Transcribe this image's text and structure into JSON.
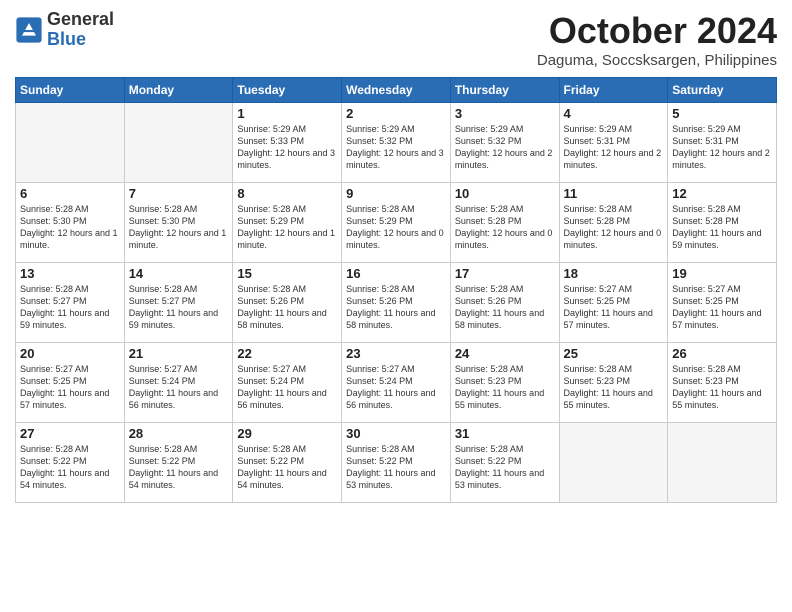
{
  "header": {
    "logo": {
      "general": "General",
      "blue": "Blue"
    },
    "month": "October 2024",
    "location": "Daguma, Soccsksargen, Philippines"
  },
  "weekdays": [
    "Sunday",
    "Monday",
    "Tuesday",
    "Wednesday",
    "Thursday",
    "Friday",
    "Saturday"
  ],
  "weeks": [
    [
      null,
      null,
      {
        "day": 1,
        "sunrise": "Sunrise: 5:29 AM",
        "sunset": "Sunset: 5:33 PM",
        "daylight": "Daylight: 12 hours and 3 minutes."
      },
      {
        "day": 2,
        "sunrise": "Sunrise: 5:29 AM",
        "sunset": "Sunset: 5:32 PM",
        "daylight": "Daylight: 12 hours and 3 minutes."
      },
      {
        "day": 3,
        "sunrise": "Sunrise: 5:29 AM",
        "sunset": "Sunset: 5:32 PM",
        "daylight": "Daylight: 12 hours and 2 minutes."
      },
      {
        "day": 4,
        "sunrise": "Sunrise: 5:29 AM",
        "sunset": "Sunset: 5:31 PM",
        "daylight": "Daylight: 12 hours and 2 minutes."
      },
      {
        "day": 5,
        "sunrise": "Sunrise: 5:29 AM",
        "sunset": "Sunset: 5:31 PM",
        "daylight": "Daylight: 12 hours and 2 minutes."
      }
    ],
    [
      {
        "day": 6,
        "sunrise": "Sunrise: 5:28 AM",
        "sunset": "Sunset: 5:30 PM",
        "daylight": "Daylight: 12 hours and 1 minute."
      },
      {
        "day": 7,
        "sunrise": "Sunrise: 5:28 AM",
        "sunset": "Sunset: 5:30 PM",
        "daylight": "Daylight: 12 hours and 1 minute."
      },
      {
        "day": 8,
        "sunrise": "Sunrise: 5:28 AM",
        "sunset": "Sunset: 5:29 PM",
        "daylight": "Daylight: 12 hours and 1 minute."
      },
      {
        "day": 9,
        "sunrise": "Sunrise: 5:28 AM",
        "sunset": "Sunset: 5:29 PM",
        "daylight": "Daylight: 12 hours and 0 minutes."
      },
      {
        "day": 10,
        "sunrise": "Sunrise: 5:28 AM",
        "sunset": "Sunset: 5:28 PM",
        "daylight": "Daylight: 12 hours and 0 minutes."
      },
      {
        "day": 11,
        "sunrise": "Sunrise: 5:28 AM",
        "sunset": "Sunset: 5:28 PM",
        "daylight": "Daylight: 12 hours and 0 minutes."
      },
      {
        "day": 12,
        "sunrise": "Sunrise: 5:28 AM",
        "sunset": "Sunset: 5:28 PM",
        "daylight": "Daylight: 11 hours and 59 minutes."
      }
    ],
    [
      {
        "day": 13,
        "sunrise": "Sunrise: 5:28 AM",
        "sunset": "Sunset: 5:27 PM",
        "daylight": "Daylight: 11 hours and 59 minutes."
      },
      {
        "day": 14,
        "sunrise": "Sunrise: 5:28 AM",
        "sunset": "Sunset: 5:27 PM",
        "daylight": "Daylight: 11 hours and 59 minutes."
      },
      {
        "day": 15,
        "sunrise": "Sunrise: 5:28 AM",
        "sunset": "Sunset: 5:26 PM",
        "daylight": "Daylight: 11 hours and 58 minutes."
      },
      {
        "day": 16,
        "sunrise": "Sunrise: 5:28 AM",
        "sunset": "Sunset: 5:26 PM",
        "daylight": "Daylight: 11 hours and 58 minutes."
      },
      {
        "day": 17,
        "sunrise": "Sunrise: 5:28 AM",
        "sunset": "Sunset: 5:26 PM",
        "daylight": "Daylight: 11 hours and 58 minutes."
      },
      {
        "day": 18,
        "sunrise": "Sunrise: 5:27 AM",
        "sunset": "Sunset: 5:25 PM",
        "daylight": "Daylight: 11 hours and 57 minutes."
      },
      {
        "day": 19,
        "sunrise": "Sunrise: 5:27 AM",
        "sunset": "Sunset: 5:25 PM",
        "daylight": "Daylight: 11 hours and 57 minutes."
      }
    ],
    [
      {
        "day": 20,
        "sunrise": "Sunrise: 5:27 AM",
        "sunset": "Sunset: 5:25 PM",
        "daylight": "Daylight: 11 hours and 57 minutes."
      },
      {
        "day": 21,
        "sunrise": "Sunrise: 5:27 AM",
        "sunset": "Sunset: 5:24 PM",
        "daylight": "Daylight: 11 hours and 56 minutes."
      },
      {
        "day": 22,
        "sunrise": "Sunrise: 5:27 AM",
        "sunset": "Sunset: 5:24 PM",
        "daylight": "Daylight: 11 hours and 56 minutes."
      },
      {
        "day": 23,
        "sunrise": "Sunrise: 5:27 AM",
        "sunset": "Sunset: 5:24 PM",
        "daylight": "Daylight: 11 hours and 56 minutes."
      },
      {
        "day": 24,
        "sunrise": "Sunrise: 5:28 AM",
        "sunset": "Sunset: 5:23 PM",
        "daylight": "Daylight: 11 hours and 55 minutes."
      },
      {
        "day": 25,
        "sunrise": "Sunrise: 5:28 AM",
        "sunset": "Sunset: 5:23 PM",
        "daylight": "Daylight: 11 hours and 55 minutes."
      },
      {
        "day": 26,
        "sunrise": "Sunrise: 5:28 AM",
        "sunset": "Sunset: 5:23 PM",
        "daylight": "Daylight: 11 hours and 55 minutes."
      }
    ],
    [
      {
        "day": 27,
        "sunrise": "Sunrise: 5:28 AM",
        "sunset": "Sunset: 5:22 PM",
        "daylight": "Daylight: 11 hours and 54 minutes."
      },
      {
        "day": 28,
        "sunrise": "Sunrise: 5:28 AM",
        "sunset": "Sunset: 5:22 PM",
        "daylight": "Daylight: 11 hours and 54 minutes."
      },
      {
        "day": 29,
        "sunrise": "Sunrise: 5:28 AM",
        "sunset": "Sunset: 5:22 PM",
        "daylight": "Daylight: 11 hours and 54 minutes."
      },
      {
        "day": 30,
        "sunrise": "Sunrise: 5:28 AM",
        "sunset": "Sunset: 5:22 PM",
        "daylight": "Daylight: 11 hours and 53 minutes."
      },
      {
        "day": 31,
        "sunrise": "Sunrise: 5:28 AM",
        "sunset": "Sunset: 5:22 PM",
        "daylight": "Daylight: 11 hours and 53 minutes."
      },
      null,
      null
    ]
  ]
}
